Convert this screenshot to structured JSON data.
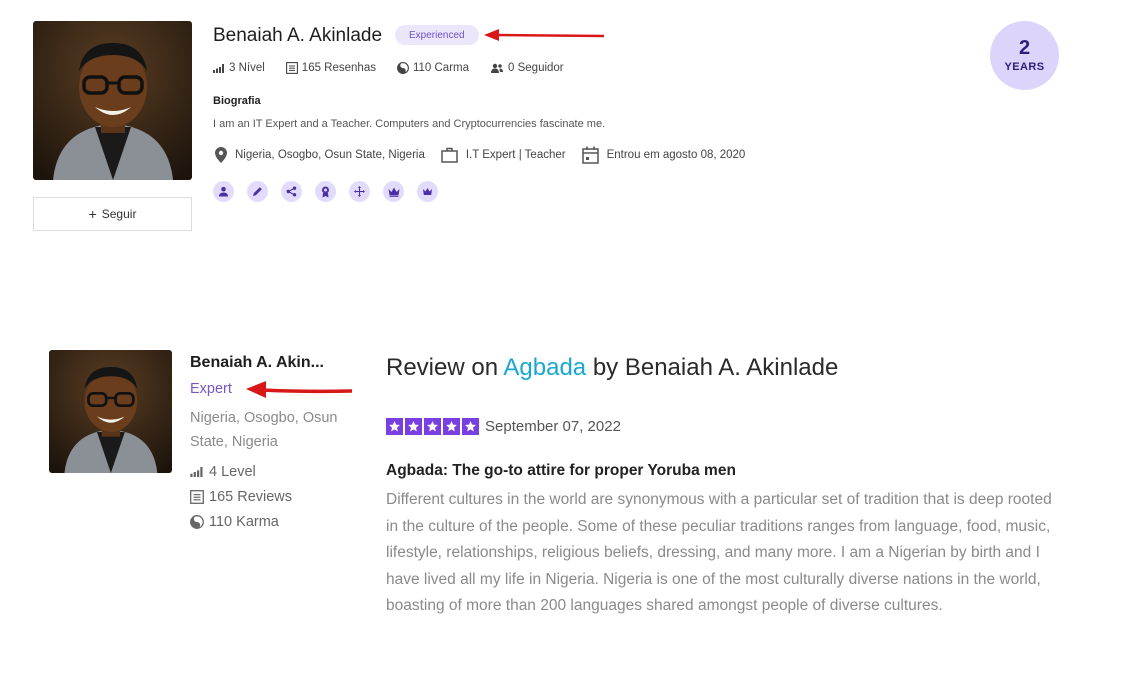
{
  "profile": {
    "name": "Benaiah A. Akinlade",
    "badge": "Experienced",
    "follow_label": "Seguir",
    "stats": {
      "level": "3 Nível",
      "reviews": "165 Resenhas",
      "karma": "110 Carma",
      "followers": "0 Seguidor"
    },
    "bio_heading": "Biografia",
    "bio_text": "I am an IT Expert and a Teacher. Computers and Cryptocurrencies fascinate me.",
    "location": "Nigeria, Osogbo, Osun State, Nigeria",
    "occupation": "I.T Expert | Teacher",
    "joined": "Entrou em agosto 08, 2020",
    "achievement_icons": [
      "person-icon",
      "pencil-icon",
      "share-icon",
      "award-icon",
      "move-icon",
      "crown-icon",
      "crown-badge-icon"
    ],
    "years_number": "2",
    "years_label": "YEARS"
  },
  "review": {
    "author_name": "Benaiah A.  Akin...",
    "author_rank": "Expert",
    "author_location": "Nigeria, Osogbo, Osun State, Nigeria",
    "author_level": "4 Level",
    "author_reviews": "165 Reviews",
    "author_karma": "110 Karma",
    "title_prefix": "Review on",
    "product": "Agbada",
    "title_suffix": "by Benaiah A. Akinlade",
    "rating": 5,
    "date": "September 07, 2022",
    "headline": "Agbada: The go-to attire for proper Yoruba men",
    "body": "Different cultures in the world are synonymous with a particular set of tradition that is deep rooted in the culture of the people. Some of these peculiar traditions ranges from language, food, music, lifestyle, relationships, religious beliefs, dressing, and many more. I am a Nigerian by birth and I have lived all my life in Nigeria. Nigeria is one of the most culturally diverse nations in the world, boasting of more than 200 languages shared amongst people of diverse cultures."
  },
  "colors": {
    "accent_purple": "#7a3fe0",
    "badge_bg": "#ece6fb",
    "product_link": "#1aa7cf",
    "arrow_red": "#d81818"
  }
}
